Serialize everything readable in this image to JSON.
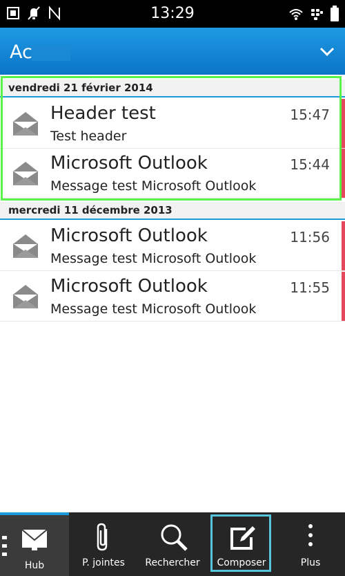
{
  "status_bar": {
    "time": "13:29"
  },
  "title_bar": {
    "title": "Ac"
  },
  "sections": [
    {
      "date": "vendredi 21 février 2014",
      "items": [
        {
          "subject": "Header test",
          "time": "15:47",
          "preview": "Test header"
        },
        {
          "subject": "Microsoft Outlook",
          "time": "15:44",
          "preview": "Message test Microsoft Outlook"
        }
      ]
    },
    {
      "date": "mercredi 11 décembre 2013",
      "items": [
        {
          "subject": "Microsoft Outlook",
          "time": "11:56",
          "preview": "Message test Microsoft Outlook"
        },
        {
          "subject": "Microsoft Outlook",
          "time": "11:55",
          "preview": "Message test Microsoft Outlook"
        }
      ]
    }
  ],
  "action_bar": {
    "hub": "Hub",
    "attachments": "P. jointes",
    "search": "Rechercher",
    "compose": "Composer",
    "more": "Plus"
  },
  "colors": {
    "accent": "#1b9ad9",
    "flag": "#e5485b",
    "highlight": "#59f34a"
  }
}
